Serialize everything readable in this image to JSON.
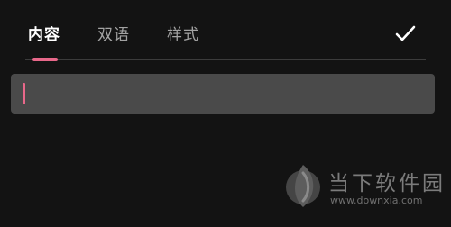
{
  "tabs": [
    {
      "label": "内容",
      "active": true
    },
    {
      "label": "双语",
      "active": false
    },
    {
      "label": "样式",
      "active": false
    }
  ],
  "confirm": {
    "icon": "check-icon"
  },
  "input": {
    "value": "",
    "caret_color": "#e8688a"
  },
  "colors": {
    "background": "#131313",
    "accent": "#e8688a",
    "input_bg": "#4a4a4a",
    "tab_active": "#ffffff",
    "tab_inactive": "#a3a3a3"
  },
  "watermark": {
    "title": "当下软件园",
    "url": "www.downxia.com",
    "icon": "downxia-logo"
  }
}
